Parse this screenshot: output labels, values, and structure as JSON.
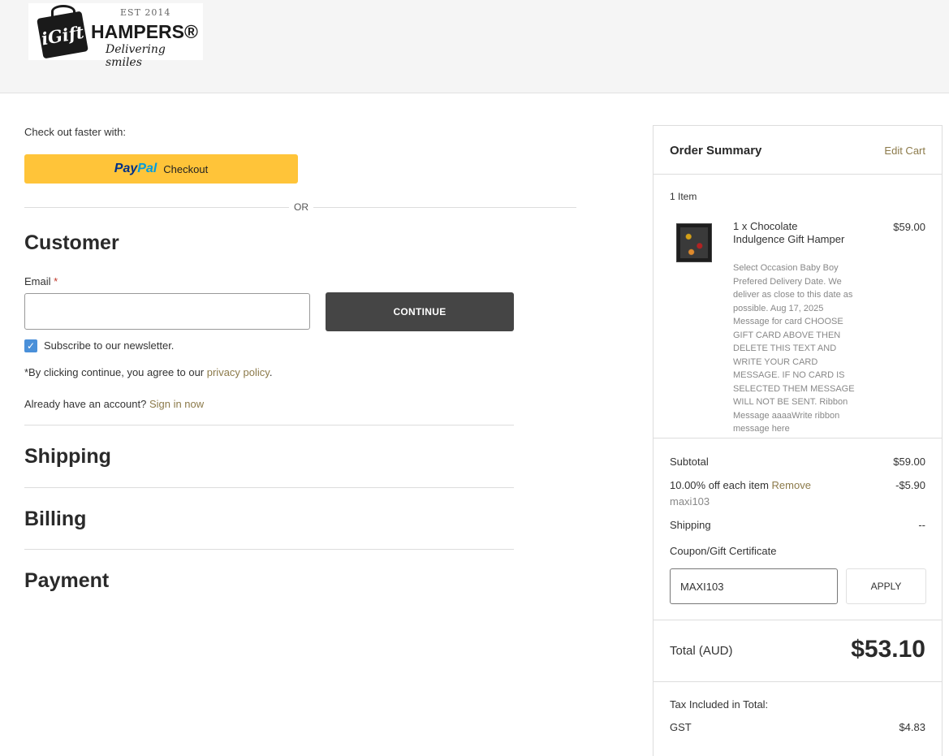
{
  "brand": {
    "est": "EST 2014",
    "logo_mark": "iGift",
    "name": "HAMPERS®",
    "tagline": "Delivering smiles"
  },
  "checkout": {
    "faster_label": "Check out faster with:",
    "paypal": {
      "brand_a": "Pay",
      "brand_b": "Pal",
      "label": "Checkout"
    },
    "or_label": "OR",
    "customer_heading": "Customer",
    "email_label": "Email",
    "email_required": "*",
    "email_value": "",
    "continue_label": "CONTINUE",
    "newsletter_label": "Subscribe to our newsletter.",
    "newsletter_checked": true,
    "terms_prefix": "*By clicking continue, you agree to our ",
    "terms_link": "privacy policy",
    "terms_suffix": ".",
    "account_prefix": "Already have an account? ",
    "account_link": "Sign in now",
    "shipping_heading": "Shipping",
    "billing_heading": "Billing",
    "payment_heading": "Payment"
  },
  "summary": {
    "title": "Order Summary",
    "edit_cart": "Edit Cart",
    "item_count": "1 Item",
    "item": {
      "name": "1 x Chocolate Indulgence Gift Hamper",
      "price": "$59.00",
      "options": "Select Occasion Baby Boy Prefered Delivery Date. We deliver as close to this date as possible. Aug 17, 2025 Message for card CHOOSE GIFT CARD ABOVE THEN DELETE THIS TEXT AND WRITE YOUR CARD MESSAGE. IF NO CARD IS SELECTED THEM MESSAGE WILL NOT BE SENT. Ribbon Message aaaaWrite ribbon message here"
    },
    "subtotal_label": "Subtotal",
    "subtotal_value": "$59.00",
    "discount_label": "10.00% off each item",
    "discount_remove": "Remove",
    "discount_value": "-$5.90",
    "discount_code": "maxi103",
    "shipping_label": "Shipping",
    "shipping_value": "--",
    "coupon_label": "Coupon/Gift Certificate",
    "coupon_value": "MAXI103",
    "apply_label": "APPLY",
    "total_label": "Total (AUD)",
    "total_value": "$53.10",
    "tax_label": "Tax Included in Total:",
    "gst_label": "GST",
    "gst_value": "$4.83"
  }
}
